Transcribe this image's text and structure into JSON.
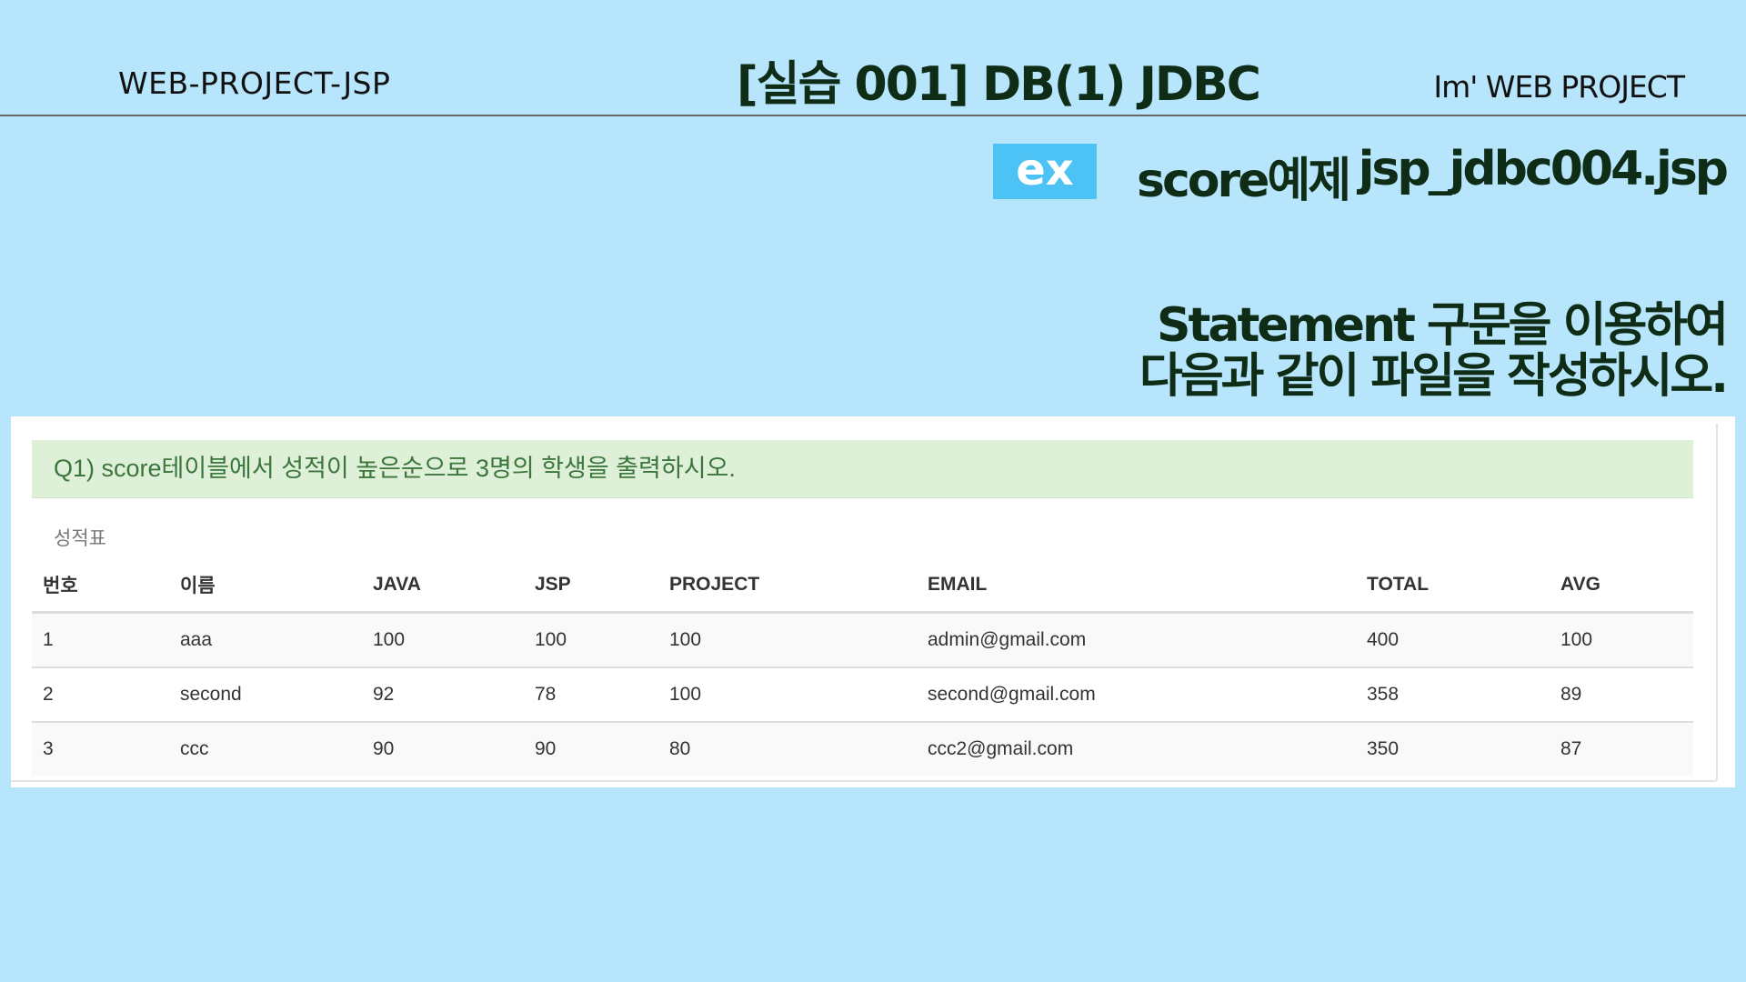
{
  "header": {
    "left_title": "WEB-PROJECT-JSP",
    "center_title": "[실습 001]  DB(1) JDBC",
    "right_title": "Im'  WEB PROJECT"
  },
  "example": {
    "badge": "ex",
    "title": "score예제",
    "file": "jsp_jdbc004.jsp"
  },
  "instruction": {
    "line1": "Statement 구문을 이용하여",
    "line2": "다음과 같이 파일을 작성하시오."
  },
  "screenshot": {
    "question": "Q1) score테이블에서 성적이 높은순으로 3명의 학생을 출력하시오.",
    "caption": "성적표",
    "columns": [
      "번호",
      "이름",
      "JAVA",
      "JSP",
      "PROJECT",
      "EMAIL",
      "TOTAL",
      "AVG"
    ],
    "rows": [
      [
        "1",
        "aaa",
        "100",
        "100",
        "100",
        "admin@gmail.com",
        "400",
        "100"
      ],
      [
        "2",
        "second",
        "92",
        "78",
        "100",
        "second@gmail.com",
        "358",
        "89"
      ],
      [
        "3",
        "ccc",
        "90",
        "90",
        "80",
        "ccc2@gmail.com",
        "350",
        "87"
      ]
    ]
  },
  "colors": {
    "background": "#b7e6fc",
    "badge": "#4dc3f5",
    "title_text": "#0f2d16",
    "alert_bg": "#dff0d8",
    "alert_text": "#3c763d"
  }
}
